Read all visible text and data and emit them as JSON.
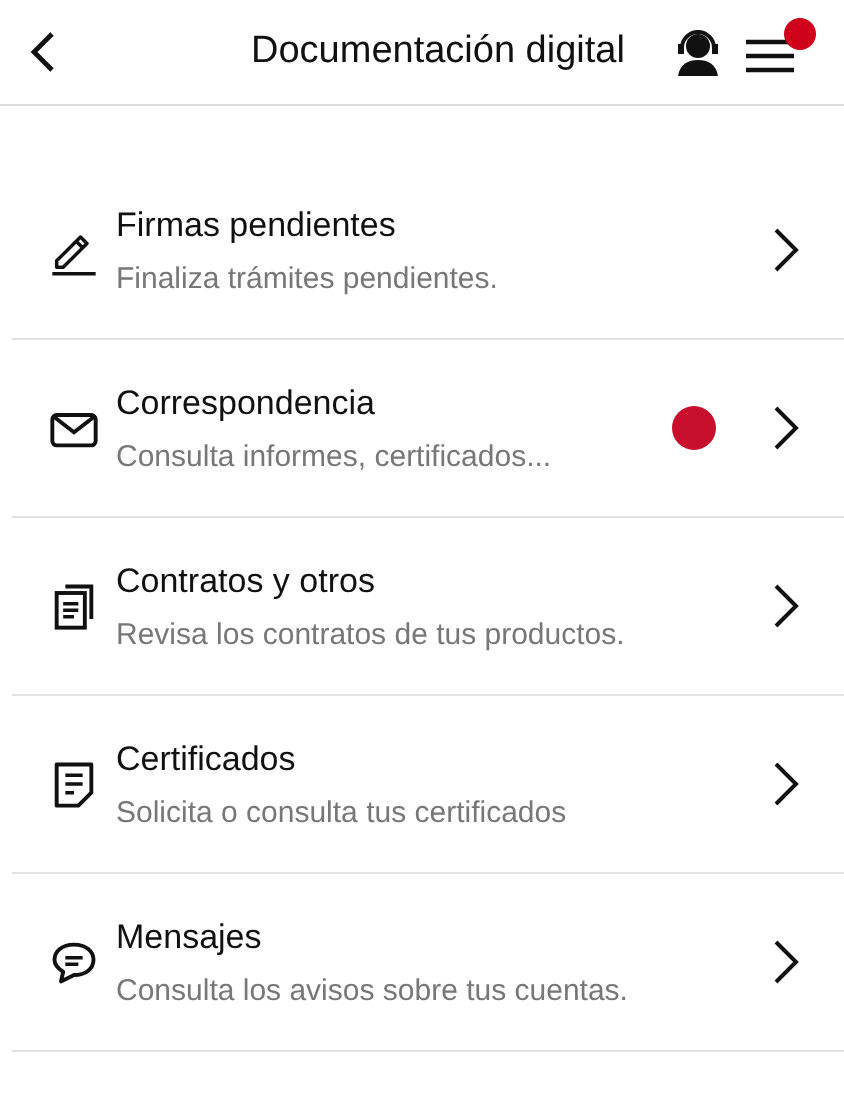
{
  "header": {
    "title": "Documentación digital",
    "menu_badge": true
  },
  "items": [
    {
      "kind": "pen",
      "title": "Firmas pendientes",
      "subtitle": "Finaliza trámites pendientes.",
      "unread": false
    },
    {
      "kind": "mail",
      "title": "Correspondencia",
      "subtitle": "Consulta informes, certificados...",
      "unread": true
    },
    {
      "kind": "documents",
      "title": "Contratos y otros",
      "subtitle": "Revisa los contratos de tus productos.",
      "unread": false
    },
    {
      "kind": "document",
      "title": "Certificados",
      "subtitle": "Solicita o consulta tus certificados",
      "unread": false
    },
    {
      "kind": "chat",
      "title": "Mensajes",
      "subtitle": "Consulta los avisos sobre tus cuentas.",
      "unread": false
    }
  ]
}
